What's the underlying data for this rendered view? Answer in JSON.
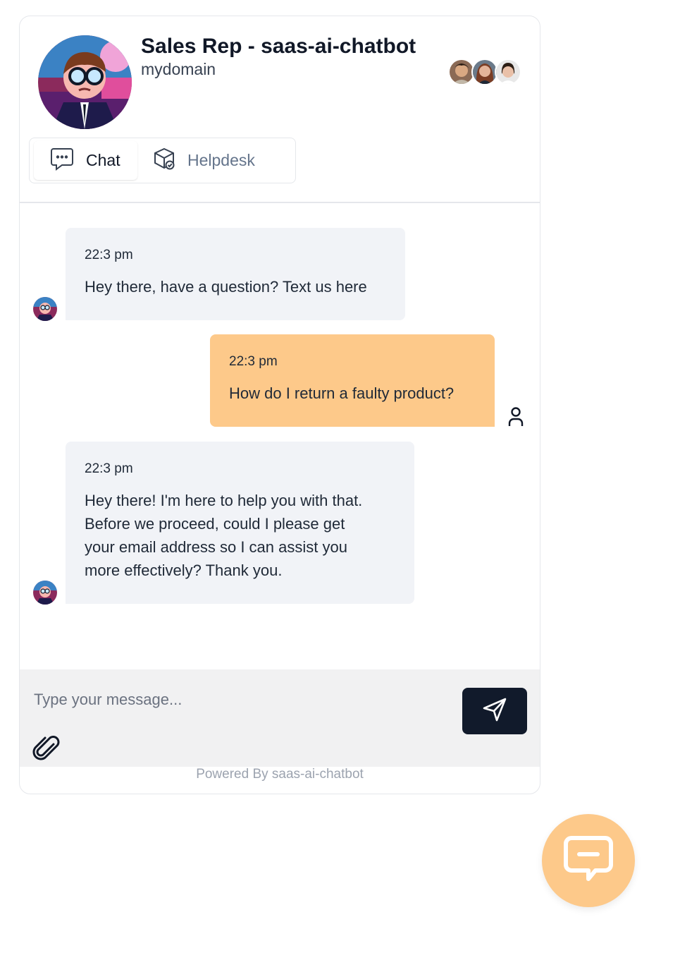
{
  "header": {
    "title": "Sales Rep - saas-ai-chatbot",
    "subtitle": "mydomain",
    "avatar_icon": "bot-avatar-icon",
    "reps": [
      "rep-avatar-1",
      "rep-avatar-2",
      "rep-avatar-3"
    ]
  },
  "tabs": [
    {
      "label": "Chat",
      "icon": "chat-bubble-icon",
      "active": true
    },
    {
      "label": "Helpdesk",
      "icon": "helpdesk-box-icon",
      "active": false
    }
  ],
  "messages": [
    {
      "role": "bot",
      "time": "22:3 pm",
      "text": "Hey there, have a question? Text us here"
    },
    {
      "role": "user",
      "time": "22:3 pm",
      "text": "How do I return a faulty product?"
    },
    {
      "role": "bot",
      "time": "22:3 pm",
      "lines": [
        "Hey there! I'm here to help you with that.",
        "Before we proceed, could I please get",
        "your email address so I can assist you",
        "more effectively? Thank you."
      ]
    }
  ],
  "composer": {
    "placeholder": "Type your message...",
    "send_icon": "send-icon",
    "attach_icon": "paperclip-icon"
  },
  "footer": {
    "powered_by": "Powered By saas-ai-chatbot"
  },
  "launcher": {
    "icon": "chat-launcher-icon"
  },
  "colors": {
    "accent": "#fdc98a",
    "bot_bubble": "#f1f3f7",
    "send_button": "#111a2b"
  }
}
